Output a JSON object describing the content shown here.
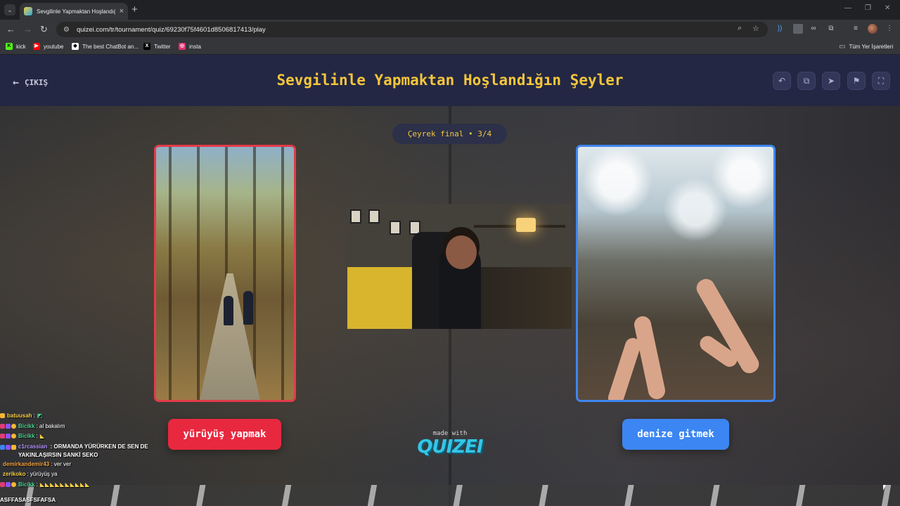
{
  "browser": {
    "tab_title": "Sevgilinle Yapmaktan Hoşlandığ",
    "url": "quizei.com/tr/tournament/quiz/69230f75f4601d8506817413/play",
    "bookmarks": [
      {
        "label": "kick",
        "icon": "kick-icon",
        "color": "#53fc18"
      },
      {
        "label": "youtube",
        "icon": "youtube-icon",
        "color": "#ff0000"
      },
      {
        "label": "The best ChatBot an...",
        "icon": "chatbot-icon",
        "color": "#ffffff"
      },
      {
        "label": "Twitter",
        "icon": "x-icon",
        "color": "#000000"
      },
      {
        "label": "insta",
        "icon": "instagram-icon",
        "color": "#e1306c"
      }
    ],
    "all_bookmarks_label": "Tüm Yer İşaretleri"
  },
  "header": {
    "exit_label": "ÇIKIŞ",
    "title": "Sevgilinle Yapmaktan Hoşlandığın Şeyler",
    "actions": [
      "undo-icon",
      "share-icon",
      "send-icon",
      "flag-icon",
      "fullscreen-icon"
    ]
  },
  "round": {
    "label": "Çeyrek final • 3/4"
  },
  "options": {
    "left": {
      "label": "yürüyüş yapmak",
      "color": "#e8283f",
      "border": "#e23b4a"
    },
    "right": {
      "label": "denize gitmek",
      "color": "#3b86f2",
      "border": "#3f86f0"
    }
  },
  "branding": {
    "made_with": "made with",
    "logo": "QUIZEI"
  },
  "chat": [
    {
      "user": "batuusah",
      "color": "#f7d046",
      "message": ":"
    },
    {
      "user": "Bicikk",
      "color": "#4ad493",
      "message": ": al bakalım"
    },
    {
      "user": "Bicikk",
      "color": "#4ad493",
      "message": ":"
    },
    {
      "user": "c1rcassian",
      "color": "#b693ff",
      "message": ": ORMANDA YÜRÜRKEN DE SEN DE YAKINLAŞIRSIN SANKİ SEKO"
    },
    {
      "user": "demirkandemir43",
      "color": "#f6a23b",
      "message": ": ver ver"
    },
    {
      "user": "zerikoko",
      "color": "#f7d046",
      "message": ": yürüyüş ya"
    },
    {
      "user": "Bicikk",
      "color": "#4ad493",
      "message": ":"
    }
  ],
  "overlay_text": "ASFFASASFSFAFSA"
}
